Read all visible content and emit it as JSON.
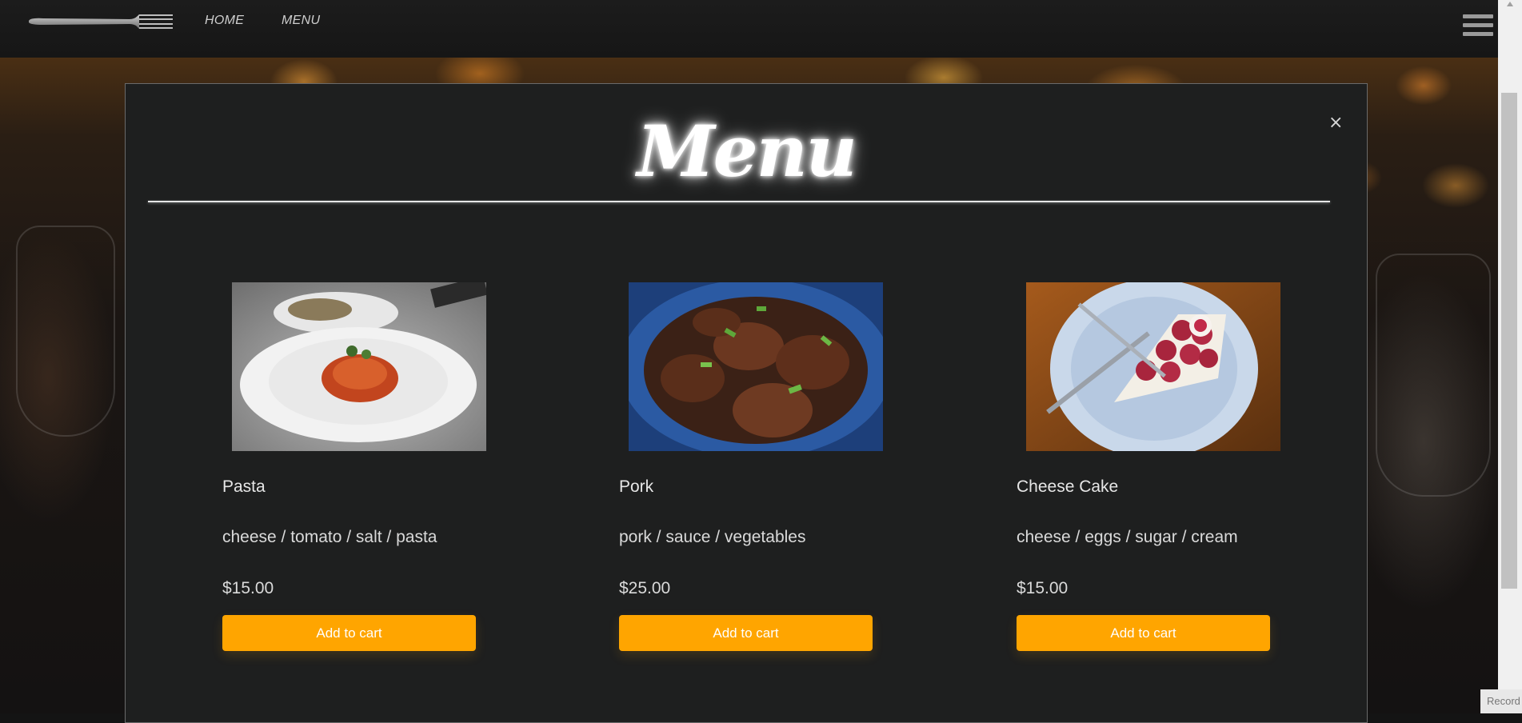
{
  "nav": {
    "home_label": "HOME",
    "menu_label": "MENU"
  },
  "modal": {
    "title": "Menu",
    "close_label": "×"
  },
  "items": [
    {
      "name": "Pasta",
      "ingredients": "cheese / tomato / salt / pasta",
      "price": "$15.00",
      "button_label": "Add to cart",
      "image": "pasta-photo"
    },
    {
      "name": "Pork",
      "ingredients": "pork / sauce / vegetables",
      "price": "$25.00",
      "button_label": "Add to cart",
      "image": "pork-photo"
    },
    {
      "name": "Cheese Cake",
      "ingredients": "cheese / eggs / sugar / cream",
      "price": "$15.00",
      "button_label": "Add to cart",
      "image": "cheesecake-photo"
    }
  ],
  "recorder": {
    "label": "Record"
  },
  "colors": {
    "accent": "#ffa500",
    "modal_bg": "#1e1f1f",
    "nav_bg": "#161616"
  }
}
